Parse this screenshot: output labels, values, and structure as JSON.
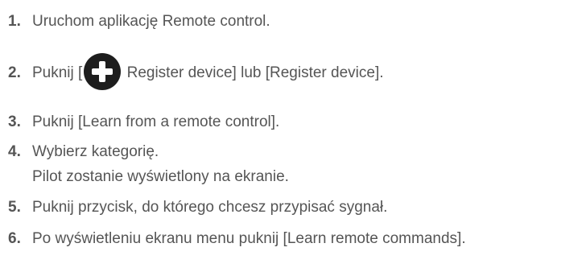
{
  "steps": [
    {
      "number": "1.",
      "text": "Uruchom aplikację Remote control."
    },
    {
      "number": "2.",
      "text_before": "Puknij [",
      "icon": "add-icon",
      "text_after": " Register device] lub [Register device]."
    },
    {
      "number": "3.",
      "text": "Puknij [Learn from a remote control]."
    },
    {
      "number": "4.",
      "text": "Wybierz kategorię.",
      "subtext": "Pilot zostanie wyświetlony na ekranie."
    },
    {
      "number": "5.",
      "text": "Puknij przycisk, do którego chcesz przypisać sygnał."
    },
    {
      "number": "6.",
      "text": "Po wyświetleniu ekranu menu puknij [Learn remote commands]."
    }
  ]
}
